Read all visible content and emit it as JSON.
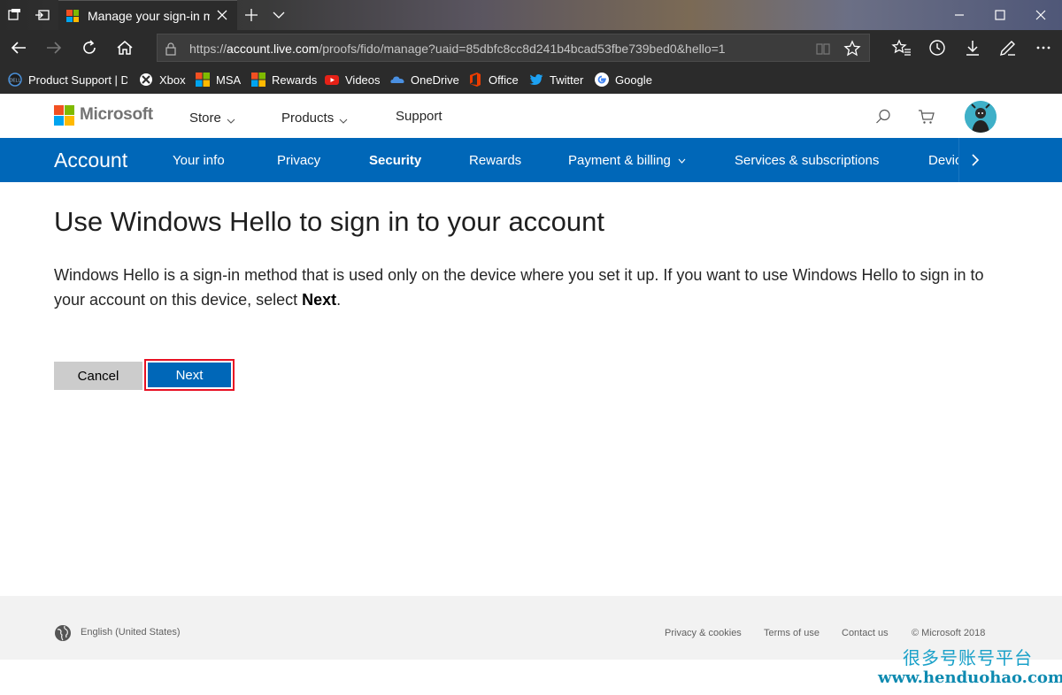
{
  "browser": {
    "tab_title": "Manage your sign-in m",
    "url_prefix": "https://",
    "url_host": "account.live.com",
    "url_path": "/proofs/fido/manage?uaid=85dbfc8cc8d241b4bcad53fbe739bed0&hello=1",
    "favorites": [
      {
        "label": "Product Support | De",
        "icon": "dell-icon"
      },
      {
        "label": "Xbox",
        "icon": "xbox-icon"
      },
      {
        "label": "MSA",
        "icon": "microsoft-icon"
      },
      {
        "label": "Rewards",
        "icon": "microsoft-icon"
      },
      {
        "label": "Videos",
        "icon": "youtube-icon"
      },
      {
        "label": "OneDrive",
        "icon": "onedrive-icon"
      },
      {
        "label": "Office",
        "icon": "office-icon"
      },
      {
        "label": "Twitter",
        "icon": "twitter-icon"
      },
      {
        "label": "Google",
        "icon": "google-icon"
      }
    ]
  },
  "header": {
    "brand": "Microsoft",
    "links": [
      {
        "label": "Store"
      },
      {
        "label": "Products"
      },
      {
        "label": "Support"
      }
    ]
  },
  "account_nav": {
    "brand": "Account",
    "items": [
      {
        "label": "Your info"
      },
      {
        "label": "Privacy"
      },
      {
        "label": "Security"
      },
      {
        "label": "Rewards"
      },
      {
        "label": "Payment & billing"
      },
      {
        "label": "Services & subscriptions"
      },
      {
        "label": "Devices"
      }
    ],
    "active": "Security"
  },
  "main": {
    "title": "Use Windows Hello to sign in to your account",
    "desc_before": "Windows Hello is a sign-in method that is used only on the device where you set it up. If you want to use Windows Hello to sign in to your account on this device, select ",
    "desc_bold": "Next",
    "desc_after": ".",
    "cancel_label": "Cancel",
    "next_label": "Next"
  },
  "footer": {
    "language": "English (United States)",
    "links": [
      "Privacy & cookies",
      "Terms of use",
      "Contact us",
      "© Microsoft 2018"
    ]
  },
  "watermark": {
    "line1": "很多号账号平台",
    "line2": "www.henduohao.com"
  },
  "colors": {
    "accent": "#0067b8",
    "highlight": "#e81123",
    "chrome": "#2b2b2b"
  }
}
